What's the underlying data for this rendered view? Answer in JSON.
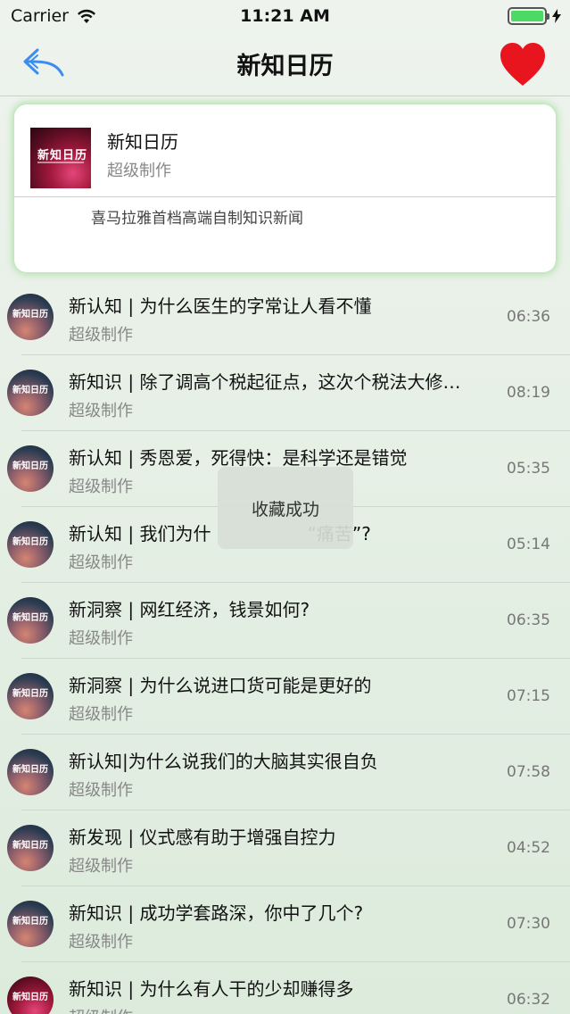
{
  "status_bar": {
    "carrier": "Carrier",
    "time": "11:21 AM"
  },
  "nav": {
    "title": "新知日历",
    "back_icon": "back-arrow-icon",
    "favorite_icon": "heart-icon",
    "accent_color": "#3b8ef0",
    "favorite_color": "#e8141e"
  },
  "album": {
    "title": "新知日历",
    "author": "超级制作",
    "description": "喜马拉雅首档高端自制知识新闻",
    "cover_text": "新知日历"
  },
  "tracks": [
    {
      "title": "新认知 | 为什么医生的字常让人看不懂",
      "author": "超级制作",
      "duration": "06:36"
    },
    {
      "title": "新知识 | 除了调高个税起征点，这次个税法大修…",
      "author": "超级制作",
      "duration": "08:19"
    },
    {
      "title": "新认知 | 秀恩爱，死得快：是科学还是错觉",
      "author": "超级制作",
      "duration": "05:35"
    },
    {
      "title": "新认知 | 我们为什                 “痛苦”?",
      "author": "超级制作",
      "duration": "05:14"
    },
    {
      "title": "新洞察 | 网红经济，钱景如何?",
      "author": "超级制作",
      "duration": "06:35"
    },
    {
      "title": "新洞察 | 为什么说进口货可能是更好的",
      "author": "超级制作",
      "duration": "07:15"
    },
    {
      "title": "新认知|为什么说我们的大脑其实很自负",
      "author": "超级制作",
      "duration": "07:58"
    },
    {
      "title": "新发现 | 仪式感有助于增强自控力",
      "author": "超级制作",
      "duration": "04:52"
    },
    {
      "title": "新知识 | 成功学套路深，你中了几个?",
      "author": "超级制作",
      "duration": "07:30"
    },
    {
      "title": "新知识 | 为什么有人干的少却赚得多",
      "author": "超级制作",
      "duration": "06:32"
    }
  ],
  "toast": {
    "message": "收藏成功"
  }
}
